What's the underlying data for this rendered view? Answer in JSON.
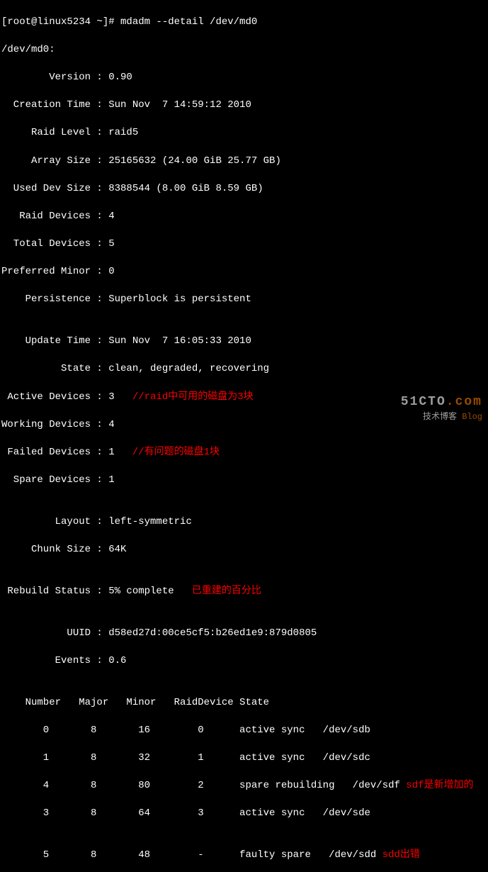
{
  "prompt": "[root@linux5234 ~]# mdadm --detail /dev/md0",
  "header": "/dev/md0:",
  "rows": {
    "version": "        Version : 0.90",
    "creation_time": "  Creation Time : Sun Nov  7 14:59:12 2010",
    "raid_level": "     Raid Level : raid5",
    "array_size": "     Array Size : 25165632 (24.00 GiB 25.77 GB)",
    "used_dev_size": "  Used Dev Size : 8388544 (8.00 GiB 8.59 GB)",
    "raid_devices": "   Raid Devices : 4",
    "total_devices": "  Total Devices : 5",
    "preferred_minor": "Preferred Minor : 0",
    "persistence": "    Persistence : Superblock is persistent",
    "blank1": "",
    "update_time": "    Update Time : Sun Nov  7 16:05:33 2010",
    "state": "          State : clean, degraded, recovering",
    "active_devices": " Active Devices : 3   ",
    "working_devices": "Working Devices : 4",
    "failed_devices": " Failed Devices : 1   ",
    "spare_devices": "  Spare Devices : 1",
    "blank2": "",
    "layout": "         Layout : left-symmetric",
    "chunk_size": "     Chunk Size : 64K",
    "blank3": "",
    "rebuild_status": " Rebuild Status : 5% complete   ",
    "blank4": "",
    "uuid": "           UUID : d58ed27d:00ce5cf5:b26ed1e9:879d0805",
    "events": "         Events : 0.6",
    "blank5": "",
    "table_header": "    Number   Major   Minor   RaidDevice State",
    "dev0": "       0       8       16        0      active sync   /dev/sdb",
    "dev1": "       1       8       32        1      active sync   /dev/sdc",
    "dev4": "       4       8       80        2      spare rebuilding   /dev/sdf ",
    "dev3": "       3       8       64        3      active sync   /dev/sde",
    "blank6": "",
    "dev5": "       5       8       48        -      faulty spare   /dev/sdd "
  },
  "annotations": {
    "active_devices": "//raid中可用的磁盘为3块",
    "failed_devices": "//有问题的磁盘1块",
    "rebuild_status": "已重建的百分比",
    "dev4": "sdf是新增加的",
    "dev5": "sdd出错"
  },
  "watermark": {
    "top_plain": "51CTO",
    "top_accent": ".com",
    "bottom_plain": "技术博客",
    "bottom_accent": "Blog"
  }
}
